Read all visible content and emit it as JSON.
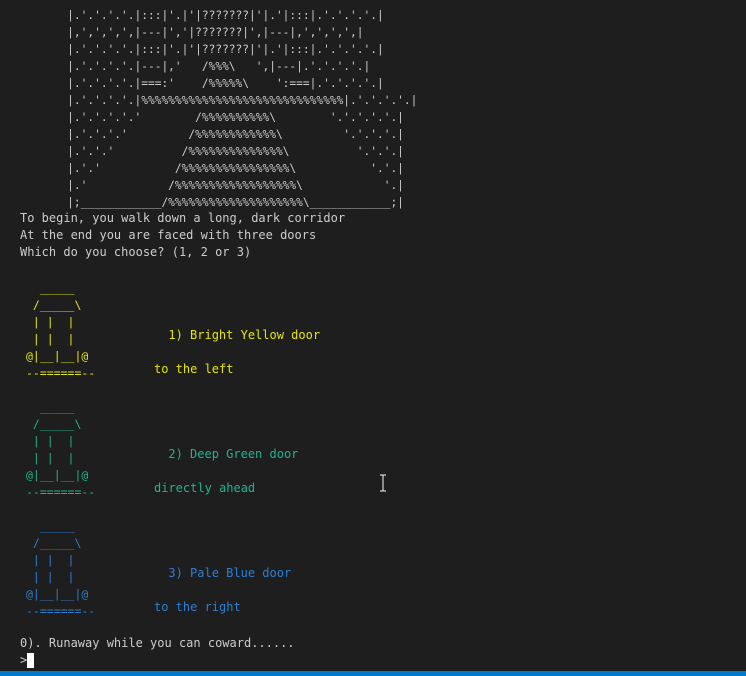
{
  "terminal": {
    "corridor_art": "       |.'.'.'.'.|:::|'.|'|???????|'|.'|:::|.'.'.'.'.|\n       |,',',',',|---|','|???????|',|---|,',',',',|\n       |.'.'.'.'.|:::|'.|'|???????|'|.'|:::|.'.'.'.'.|\n       |.'.'.'.'.|---|,'   /%%%\\   ',|---|.'.'.'.'.|\n       |.'.'.'.'.|===:'    /%%%%%\\    ':===|.'.'.'.'.|\n       |.'.'.'.'.|%%%%%%%%%%%%%%%%%%%%%%%%%%%%%%|.'.'.'.'.|\n       |.'.'.'.'.'        /%%%%%%%%%%\\        '.'.'.'.'.|\n       |.'.'.'.'         /%%%%%%%%%%%%\\         '.'.'.'.|\n       |.'.'.'          /%%%%%%%%%%%%%%\\          '.'.'.|\n       |.'.'           /%%%%%%%%%%%%%%%%\\           '.'.|\n       |.'            /%%%%%%%%%%%%%%%%%%\\            '.|\n       |;____________/%%%%%%%%%%%%%%%%%%%%\\____________;|",
    "intro_lines": [
      "To begin, you walk down a long, dark corridor",
      "At the end you are faced with three doors",
      "Which do you choose? (1, 2 or 3)"
    ],
    "door_art": "  _____\n /_____\\\n | |  |\n | |  |\n@|__|__|@\n--======--",
    "doors": [
      {
        "line1": "1) Bright Yellow door",
        "line2": "to the left",
        "color": "#e5e510"
      },
      {
        "line1": "2) Deep Green door",
        "line2": "directly ahead",
        "color": "#23b28c"
      },
      {
        "line1": "3) Pale Blue door",
        "line2": "to the right",
        "color": "#2c7fd1"
      }
    ],
    "runaway_text": "0). Runaway while you can coward......",
    "prompt": ">",
    "colors": {
      "background": "#1e1e1e",
      "foreground": "#cccccc",
      "status_bar": "#007acc",
      "cursor": "#ffffff"
    },
    "icons": {
      "mouse_cursor": "text-ibeam-icon",
      "prompt_cursor": "block-cursor-icon"
    }
  }
}
